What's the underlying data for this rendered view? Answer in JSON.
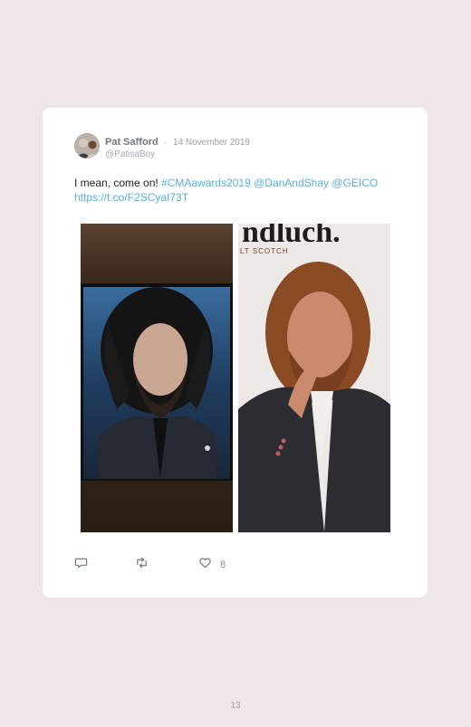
{
  "tweet": {
    "author_name": "Pat Safford",
    "separator": "·",
    "date": "14 November 2019",
    "handle": "@PatisaBoy",
    "text_plain": "I mean, come on! ",
    "hashtag": "#CMAawards2019",
    "mention1": "@DanAndShay",
    "mention2": "@GEICO",
    "link": "https://t.co/F2SCyaI73T",
    "like_count": "8",
    "images": [
      "bearded-singer-on-tv-screen",
      "caveman-in-suit-at-event"
    ],
    "right_image_sign": "ndluch.",
    "right_image_subsign": "LT SCOTCH"
  },
  "icons": [
    "reply-icon",
    "retweet-icon",
    "heart-icon"
  ],
  "colors": {
    "background": "#efe6e8",
    "card": "#ffffff",
    "link": "#5ab0dc",
    "author_name": "#707882"
  },
  "page_number": "13"
}
